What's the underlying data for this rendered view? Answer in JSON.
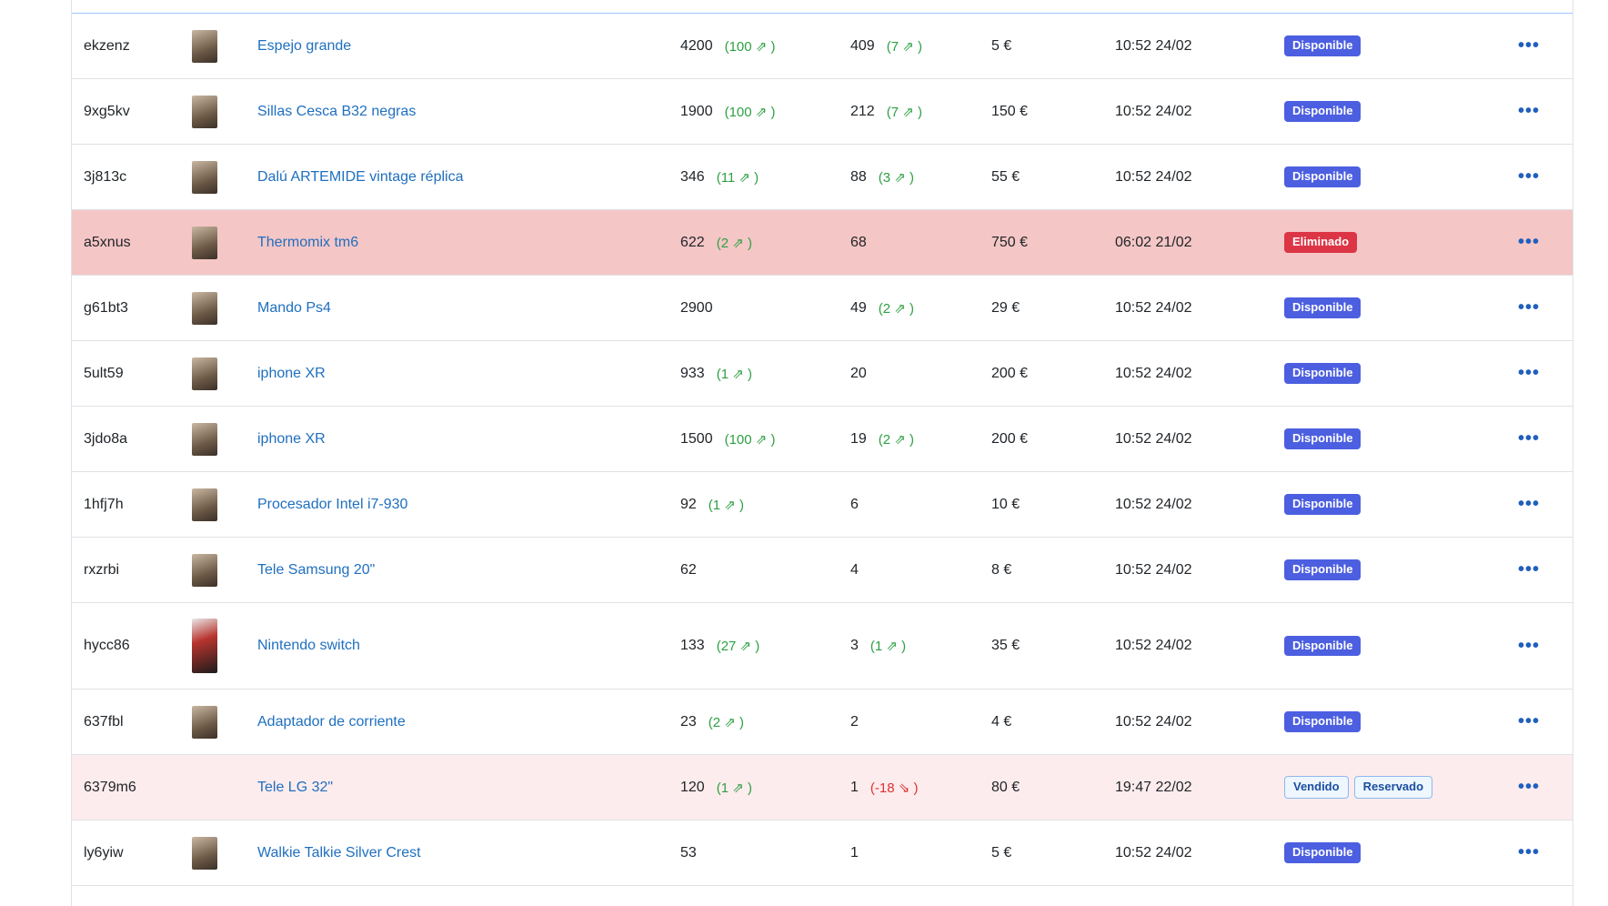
{
  "colors": {
    "available": "#4c5fe0",
    "removed": "#dc3545",
    "link": "#1f6fbf",
    "positive": "#2ea043",
    "negative": "#e03131",
    "deleted_row": "#f5c6c6",
    "sold_row": "#fdeced"
  },
  "icons": {
    "menu": "more-horizontal-icon",
    "trend_up": "trend-up-icon",
    "trend_down": "trend-down-icon"
  },
  "rows": [
    {
      "id": "ekzenz",
      "title": "Espejo grande",
      "views": "4200",
      "views_delta": "(100 ⇗ )",
      "favs": "409",
      "favs_delta": "(7 ⇗ )",
      "price": "5 €",
      "date": "10:52 24/02",
      "status": [
        "Disponible"
      ]
    },
    {
      "id": "9xg5kv",
      "title": "Sillas Cesca B32 negras",
      "views": "1900",
      "views_delta": "(100 ⇗ )",
      "favs": "212",
      "favs_delta": "(7 ⇗ )",
      "price": "150 €",
      "date": "10:52 24/02",
      "status": [
        "Disponible"
      ]
    },
    {
      "id": "3j813c",
      "title": "Dalú ARTEMIDE vintage réplica",
      "views": "346",
      "views_delta": "(11 ⇗ )",
      "favs": "88",
      "favs_delta": "(3 ⇗ )",
      "price": "55 €",
      "date": "10:52 24/02",
      "status": [
        "Disponible"
      ]
    },
    {
      "id": "a5xnus",
      "title": "Thermomix tm6",
      "views": "622",
      "views_delta": "(2 ⇗ )",
      "favs": "68",
      "favs_delta": "",
      "price": "750 €",
      "date": "06:02 21/02",
      "status": [
        "Eliminado"
      ]
    },
    {
      "id": "g61bt3",
      "title": "Mando Ps4",
      "views": "2900",
      "views_delta": "",
      "favs": "49",
      "favs_delta": "(2 ⇗ )",
      "price": "29 €",
      "date": "10:52 24/02",
      "status": [
        "Disponible"
      ]
    },
    {
      "id": "5ult59",
      "title": "iphone XR",
      "views": "933",
      "views_delta": "(1 ⇗ )",
      "favs": "20",
      "favs_delta": "",
      "price": "200 €",
      "date": "10:52 24/02",
      "status": [
        "Disponible"
      ]
    },
    {
      "id": "3jdo8a",
      "title": "iphone XR",
      "views": "1500",
      "views_delta": "(100 ⇗ )",
      "favs": "19",
      "favs_delta": "(2 ⇗ )",
      "price": "200 €",
      "date": "10:52 24/02",
      "status": [
        "Disponible"
      ]
    },
    {
      "id": "1hfj7h",
      "title": "Procesador Intel i7-930",
      "views": "92",
      "views_delta": "(1 ⇗ )",
      "favs": "6",
      "favs_delta": "",
      "price": "10 €",
      "date": "10:52 24/02",
      "status": [
        "Disponible"
      ]
    },
    {
      "id": "rxzrbi",
      "title": "Tele Samsung 20\"",
      "views": "62",
      "views_delta": "",
      "favs": "4",
      "favs_delta": "",
      "price": "8 €",
      "date": "10:52 24/02",
      "status": [
        "Disponible"
      ]
    },
    {
      "id": "hycc86",
      "title": "Nintendo switch",
      "views": "133",
      "views_delta": "(27 ⇗ )",
      "favs": "3",
      "favs_delta": "(1 ⇗ )",
      "price": "35 €",
      "date": "10:52 24/02",
      "status": [
        "Disponible"
      ]
    },
    {
      "id": "637fbl",
      "title": "Adaptador de corriente",
      "views": "23",
      "views_delta": "(2 ⇗ )",
      "favs": "2",
      "favs_delta": "",
      "price": "4 €",
      "date": "10:52 24/02",
      "status": [
        "Disponible"
      ]
    },
    {
      "id": "6379m6",
      "title": "Tele LG 32\"",
      "views": "120",
      "views_delta": "(1 ⇗ )",
      "favs": "1",
      "favs_delta": "(-18 ⇘ )",
      "price": "80 €",
      "date": "19:47 22/02",
      "status": [
        "Vendido",
        "Reservado"
      ]
    },
    {
      "id": "ly6yiw",
      "title": "Walkie Talkie Silver Crest",
      "views": "53",
      "views_delta": "",
      "favs": "1",
      "favs_delta": "",
      "price": "5 €",
      "date": "10:52 24/02",
      "status": [
        "Disponible"
      ]
    }
  ]
}
